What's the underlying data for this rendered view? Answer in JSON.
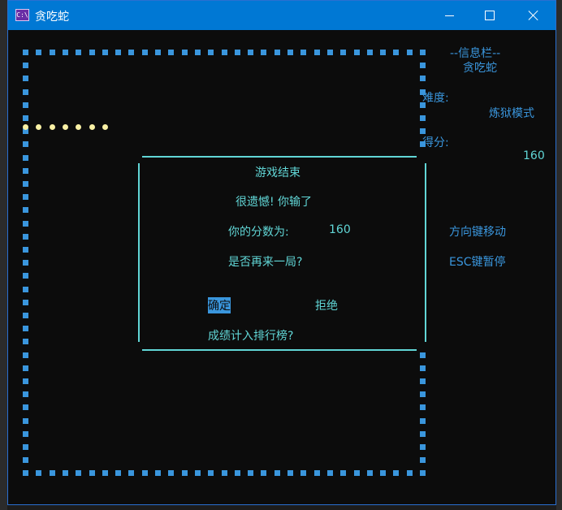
{
  "window": {
    "title": "贪吃蛇",
    "icon_text": "C:\\",
    "icon": "console-app-icon",
    "controls": [
      "minimize-icon",
      "maximize-icon",
      "close-icon"
    ]
  },
  "info_panel": {
    "header": "--信息栏--",
    "game_name": "贪吃蛇",
    "difficulty_label": "难度:",
    "difficulty_value": "炼狱模式",
    "score_label": "得分:",
    "score_value": "160",
    "hint_move": "方向键移动",
    "hint_pause": "ESC键暂停"
  },
  "dialog": {
    "title": "游戏结束",
    "message": "很遗憾! 你输了",
    "score_label": "你的分数为:",
    "score_value": "160",
    "retry_question": "是否再来一局?",
    "confirm": "确定",
    "reject": "拒绝",
    "leaderboard_question": "成绩计入排行榜?"
  },
  "colors": {
    "titlebar": "#0078d4",
    "console_bg": "#0c0c0c",
    "wall": "#3a96dd",
    "snake": "#f9f1a5",
    "dialog": "#61d6d6"
  }
}
